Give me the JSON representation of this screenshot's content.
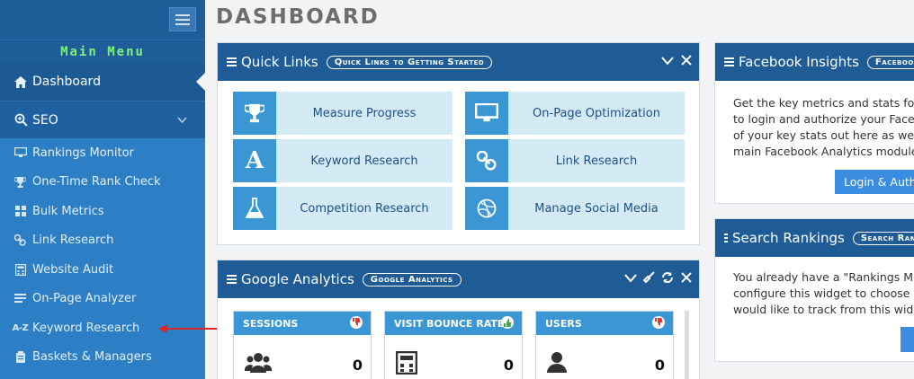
{
  "sidebar": {
    "main_menu_label": "Main Menu",
    "dashboard_label": "Dashboard",
    "seo_label": "SEO",
    "sub_items": [
      {
        "label": "Rankings Monitor",
        "icon": "monitor-icon"
      },
      {
        "label": "One-Time Rank Check",
        "icon": "trophy-icon"
      },
      {
        "label": "Bulk Metrics",
        "icon": "grid-icon"
      },
      {
        "label": "Link Research",
        "icon": "link-icon"
      },
      {
        "label": "Website Audit",
        "icon": "calculator-icon"
      },
      {
        "label": "On-Page Analyzer",
        "icon": "list-icon"
      },
      {
        "label": "Keyword Research",
        "icon": "az-icon"
      },
      {
        "label": "Baskets & Managers",
        "icon": "basket-icon"
      }
    ]
  },
  "page": {
    "title": "DASHBOARD"
  },
  "quick_links": {
    "title": "Quick Links",
    "pill": "Quick Links to Getting Started",
    "links": [
      {
        "label": "Measure Progress",
        "icon": "trophy-icon"
      },
      {
        "label": "On-Page Optimization",
        "icon": "monitor-icon"
      },
      {
        "label": "Keyword Research",
        "icon": "letter-a-icon"
      },
      {
        "label": "Link Research",
        "icon": "link-icon"
      },
      {
        "label": "Competition Research",
        "icon": "flask-icon"
      },
      {
        "label": "Manage Social Media",
        "icon": "dribbble-icon"
      }
    ]
  },
  "google_analytics": {
    "title": "Google Analytics",
    "pill": "Google Analytics",
    "stats": [
      {
        "label": "SESSIONS",
        "value": "0",
        "trend": "down",
        "trend_color": "#e03535",
        "icon": "users-icon"
      },
      {
        "label": "VISIT BOUNCE RATE",
        "value": "0",
        "trend": "up",
        "trend_color": "#3aa845",
        "icon": "calculator-icon"
      },
      {
        "label": "USERS",
        "value": "0",
        "trend": "down",
        "trend_color": "#e03535",
        "icon": "user-icon"
      }
    ]
  },
  "facebook": {
    "title": "Facebook Insights",
    "pill": "Facebook",
    "lines": [
      "Get the key metrics and stats for",
      "to login and authorize your Faceb",
      "of your key stats out here as wel",
      "main Facebook Analytics module."
    ],
    "button": "Login & Auth"
  },
  "search_rankings": {
    "title": "Search Rankings",
    "pill": "Search Rank",
    "lines": [
      "You already have a \"Rankings M",
      "configure this widget to choose",
      "would like to track from this widge"
    ]
  },
  "colors": {
    "header": "#1f5c96",
    "accent": "#3a97d4",
    "sidebar": "#2c7fc4"
  }
}
